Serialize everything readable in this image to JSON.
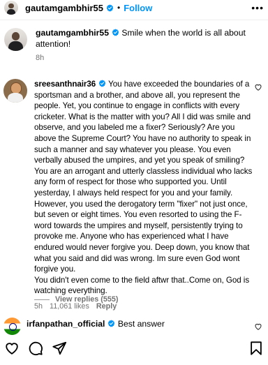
{
  "header": {
    "username": "gautamgambhir55",
    "separator": "•",
    "follow_label": "Follow",
    "more_label": "⋮"
  },
  "caption": {
    "username": "gautamgambhir55",
    "text": "Smile when the world is all about attention!",
    "time": "8h"
  },
  "comment": {
    "username": "sreesanthnair36",
    "text": "You have exceeded the boundaries of a sportsman and a brother, and above all, you represent the people. Yet, you continue to engage in conflicts with every cricketer. What is the matter with you? All I did was smile and observe, and you labeled me a fixer? Seriously? Are you above the Supreme Court? You have no authority to speak in such a manner and say whatever you please. You even verbally abused the umpires, and yet you speak of smiling? You are an arrogant and utterly classless individual who lacks any form of respect for those who supported you. Until yesterday, I always held respect for you and your family. However, you used the derogatory term \"fixer\" not just once, but seven or eight times. You even resorted to using the F-word towards the umpires and myself, persistently trying to provoke me. Anyone who has experienced what I have endured would never forgive you. Deep down, you know that what you said and did was wrong. Im sure even God wont forgive you.",
    "text2": "You didn't even come to the field aftwr that..Come on, God is watching everything.",
    "time": "5h",
    "likes": "11,061 likes",
    "reply_label": "Reply",
    "view_replies": "View replies (555)"
  },
  "comment2": {
    "username": "irfanpathan_official",
    "text": "Best answer"
  },
  "icons": {
    "verified_color": "#0095f6",
    "heart": "heart-icon",
    "comment": "comment-icon",
    "share": "share-icon",
    "save": "bookmark-icon"
  }
}
